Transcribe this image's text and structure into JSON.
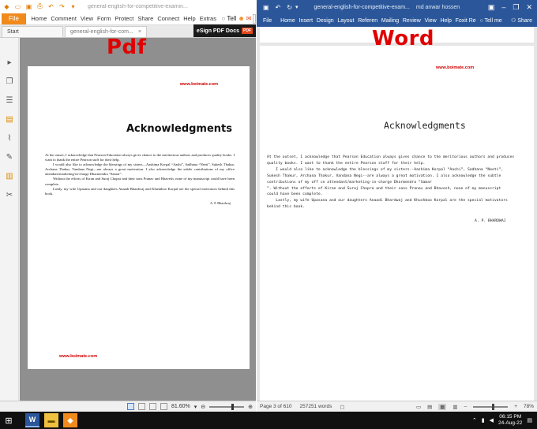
{
  "pdf": {
    "window_title": "general-english-for-competitive-examin...",
    "ribbon": {
      "file": "File",
      "items": [
        "Home",
        "Comment",
        "View",
        "Form",
        "Protect",
        "Share",
        "Connect",
        "Help",
        "Extras"
      ],
      "tell": "Tell",
      "find": "Find"
    },
    "tabs": {
      "start": "Start",
      "active": "general-english-for-com...",
      "close": "×"
    },
    "esign": {
      "label": "eSign PDF Docs",
      "badge": "PDF"
    },
    "overlay_label": "Pdf",
    "page": {
      "url_top": "www.boimate.com",
      "title": "Acknowledgments",
      "paragraphs": [
        "At the outset, I acknowledge that Pearson Education always gives chance to the meritorious authors and produces quality books. I want to thank the entire Pearson staff for their help.",
        "I would also like to acknowledge the blessings of my sisters—Aashima Korpal “Aashi”, Sadhana “Neeti”, Sukesh Thakur, Archana Thakur, Vandana Negi—are always a great motivation. I also acknowledge the subtle contributions of my office attendant/marketing-in-charge Dharmendra “Samar”.",
        "Without the efforts of Kiran and Suraj Chopra and their sons Pranav and Bhavesh, none of my manuscript could have been complete.",
        "Lastly, my wife Upasana and our daughters Anaadi Bhardwaj and Khushboo Korpal are the special motivators behind this book."
      ],
      "signature": "A. P. Bhardwaj",
      "url_bottom": "www.boimate.com"
    },
    "status": {
      "zoom": "81.60%"
    }
  },
  "word": {
    "window_title": "general-english-for-competitive-exam...",
    "user": "md anwar hossen",
    "ribbon": {
      "items": [
        "File",
        "Home",
        "Insert",
        "Design",
        "Layout",
        "Referen",
        "Mailing",
        "Review",
        "View",
        "Help",
        "Foxit Re"
      ],
      "tell": "Tell me",
      "share": "Share"
    },
    "overlay_label": "Word",
    "page": {
      "url": "www.boimate.com",
      "title": "Acknowledgments",
      "lines": [
        "At the outset, I acknowledge that Pearson Education always gives chance to the meritorious authors and produces",
        "quality books. I want to thank the entire Pearson staff for their help.",
        "    I would also like to acknowledge the blessings of my sisters--Aashima Korpal “Aashi”, Sadhana “Neeti”,",
        "Sukesh Thakur, Archana Thakur, Vandana Negi--are always a great motivation. I also acknowledge the subtle",
        "contributions of my off ce attendant/marketing-in-charge Dharmendra “Samar",
        "”. Without the efforts of Kiran and Suraj Chopra and their sons Pranav and Bhavesh, none of my manuscript",
        "could have been complete.",
        "    Lastly, my wife Upasana and our daughters Anaadi Bhardwaj and Khushboo Korpal are the special motivators",
        "behind this book."
      ],
      "signature": "A. P. BHARDWAJ"
    },
    "status": {
      "page": "Page 3 of 610",
      "words": "257251 words",
      "zoom": "78%"
    }
  },
  "taskbar": {
    "time": "06:15 PM",
    "date": "24-Aug-22"
  },
  "colors": {
    "word_blue": "#2b579a",
    "foxit_orange": "#f08a1c",
    "label_red": "#e00000"
  }
}
